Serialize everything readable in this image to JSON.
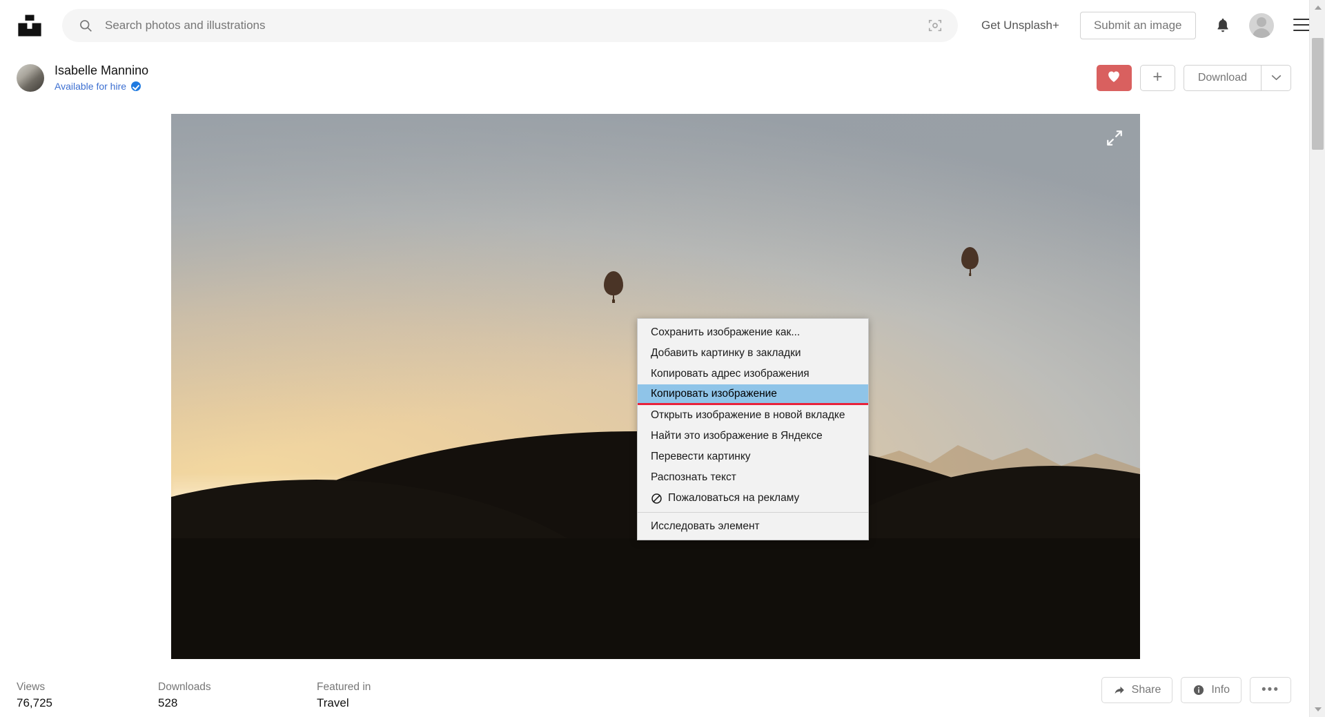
{
  "header": {
    "logo_icon": "unsplash-logo",
    "search": {
      "icon": "search-icon",
      "placeholder": "Search photos and illustrations",
      "value": "",
      "visual_search_icon": "visual-search-icon"
    },
    "get_unsplash_plus": "Get Unsplash+",
    "submit_image": "Submit an image",
    "notifications_icon": "bell-icon",
    "avatar_icon": "user-avatar",
    "hamburger_icon": "hamburger-menu-icon"
  },
  "author": {
    "avatar_icon": "author-avatar",
    "name": "Isabelle Mannino",
    "hire_status": "Available for hire",
    "verified_icon": "verified-badge-icon",
    "actions": {
      "like_icon": "heart-icon",
      "add_to_collection_icon": "plus-icon",
      "download_label": "Download",
      "download_caret_icon": "chevron-down-icon"
    }
  },
  "photo": {
    "expand_icon": "expand-arrows-icon",
    "alt": "Hot air balloons over misty desert mountains at sunrise"
  },
  "context_menu": {
    "items": [
      {
        "label": "Сохранить изображение как...",
        "icon": null,
        "selected": false,
        "separator_before": false
      },
      {
        "label": "Добавить картинку в закладки",
        "icon": null,
        "selected": false,
        "separator_before": false
      },
      {
        "label": "Копировать адрес изображения",
        "icon": null,
        "selected": false,
        "separator_before": false
      },
      {
        "label": "Копировать изображение",
        "icon": null,
        "selected": true,
        "separator_before": false
      },
      {
        "label": "Открыть изображение в новой вкладке",
        "icon": null,
        "selected": false,
        "separator_before": false
      },
      {
        "label": "Найти это изображение в Яндексе",
        "icon": null,
        "selected": false,
        "separator_before": false
      },
      {
        "label": "Перевести картинку",
        "icon": null,
        "selected": false,
        "separator_before": false
      },
      {
        "label": "Распознать текст",
        "icon": null,
        "selected": false,
        "separator_before": false
      },
      {
        "label": "Пожаловаться на рекламу",
        "icon": "block-ad-icon",
        "selected": false,
        "separator_before": false
      },
      {
        "label": "Исследовать элемент",
        "icon": null,
        "selected": false,
        "separator_before": true
      }
    ],
    "highlight_color": "#8fc4e8",
    "underline_color": "#e8223a"
  },
  "stats": {
    "views_label": "Views",
    "views_value": "76,725",
    "downloads_label": "Downloads",
    "downloads_value": "528",
    "featured_label": "Featured in",
    "featured_value": "Travel",
    "share_label": "Share",
    "share_icon": "share-arrow-icon",
    "info_label": "Info",
    "info_icon": "info-circle-icon",
    "more_label": "•••",
    "more_icon": "ellipsis-icon"
  },
  "scrollbar": {
    "up_icon": "scroll-up-arrow",
    "down_icon": "scroll-down-arrow"
  },
  "colors": {
    "accent_like": "#d9605f",
    "link_blue": "#3c6fd1",
    "verified_blue": "#1f7ae0"
  }
}
